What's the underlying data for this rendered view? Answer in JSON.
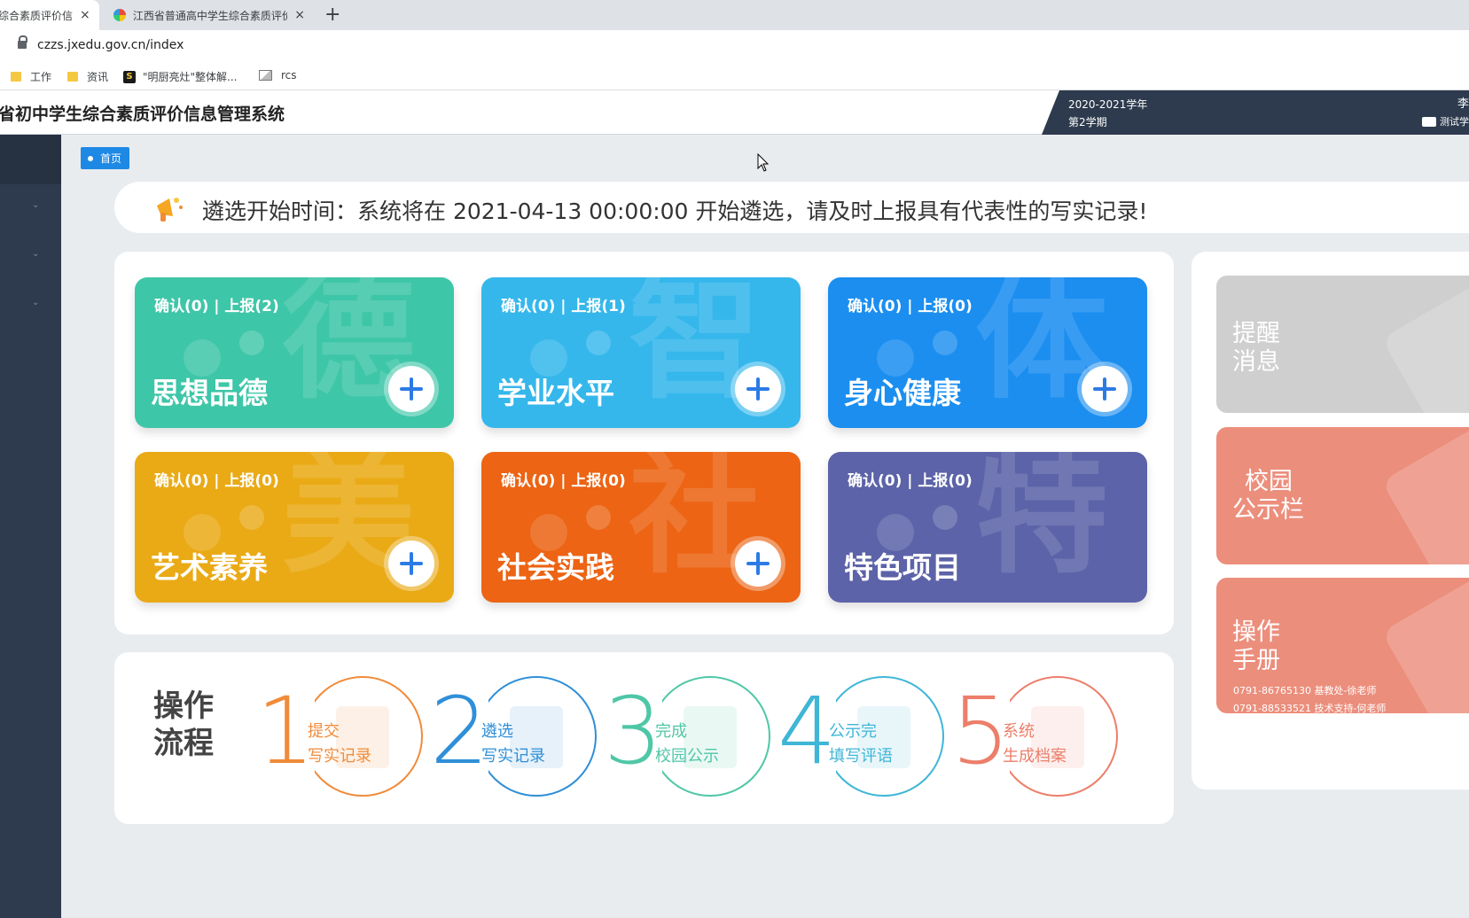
{
  "browser": {
    "tabs": [
      {
        "title": "综合素质评价信息",
        "close": "×"
      },
      {
        "title": "江西省普通高中学生综合素质评价",
        "close": "×"
      }
    ],
    "new_tab": "+",
    "url": "czzs.jxedu.gov.cn/index",
    "bookmarks": [
      {
        "label": "工作",
        "icon": "folder-icon"
      },
      {
        "label": "资讯",
        "icon": "folder-icon"
      },
      {
        "label": "\"明厨亮灶\"整体解...",
        "icon": "s-icon"
      },
      {
        "label": "rcs",
        "icon": "image-icon"
      }
    ],
    "s_glyph": "S"
  },
  "header": {
    "title": "省初中学生综合素质评价信息管理系统",
    "year": "2020-2021学年",
    "semester": "第2学期",
    "user_cut": "李",
    "user_sub": "测试学"
  },
  "breadcrumb": {
    "label": "首页"
  },
  "notice": {
    "text": "遴选开始时间：系统将在 2021-04-13 00:00:00 开始遴选，请及时上报具有代表性的写实记录!"
  },
  "cards": [
    {
      "stats": "确认(0) | 上报(2)",
      "name": "思想品德",
      "bg_char": "德",
      "color": "#3ec6a8"
    },
    {
      "stats": "确认(0) | 上报(1)",
      "name": "学业水平",
      "bg_char": "智",
      "color": "#35b7ec"
    },
    {
      "stats": "确认(0) | 上报(0)",
      "name": "身心健康",
      "bg_char": "体",
      "color": "#1b8ef0"
    },
    {
      "stats": "确认(0) | 上报(0)",
      "name": "艺术素养",
      "bg_char": "美",
      "color": "#eaaa16"
    },
    {
      "stats": "确认(0) | 上报(0)",
      "name": "社会实践",
      "bg_char": "社",
      "color": "#ec6414"
    },
    {
      "stats": "确认(0) | 上报(0)",
      "name": "特色项目",
      "bg_char": "特",
      "color": "#5c63a8"
    }
  ],
  "process": {
    "title": "操作流程",
    "steps": [
      {
        "num": "1",
        "line1": "提交",
        "line2": "写实记录",
        "color": "#f08b3a"
      },
      {
        "num": "2",
        "line1": "遴选",
        "line2": "写实记录",
        "color": "#2f8fd8"
      },
      {
        "num": "3",
        "line1": "完成",
        "line2": "校园公示",
        "color": "#4fc7a6"
      },
      {
        "num": "4",
        "line1": "公示完",
        "line2": "填写评语",
        "color": "#3fb6d6"
      },
      {
        "num": "5",
        "line1": "系统",
        "line2": "生成档案",
        "color": "#ec7e6a"
      }
    ]
  },
  "side_cards": [
    {
      "title": "提醒消息",
      "line1": "提醒",
      "line2": "消息",
      "color": "#cfcfcf"
    },
    {
      "title": "校园公示栏",
      "line1": "校园",
      "line2": "公示栏",
      "color": "#ec8e7c"
    },
    {
      "title": "操作手册",
      "line1": "操作",
      "line2": "手册",
      "color": "#ec8e7c",
      "contact1": "0791-86765130 基教处-徐老师",
      "contact2": "0791-88533521 技术支持-何老师"
    }
  ]
}
